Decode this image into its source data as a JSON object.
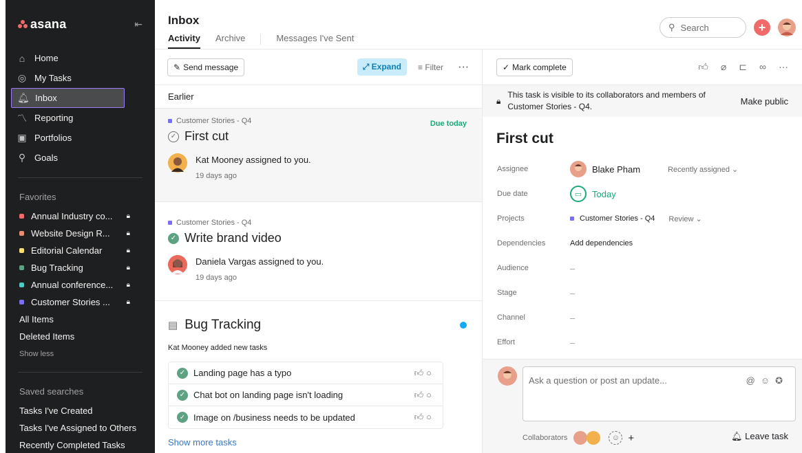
{
  "sidebar": {
    "logo": "asana",
    "nav": [
      {
        "label": "Home",
        "icon": "home-icon"
      },
      {
        "label": "My Tasks",
        "icon": "check-circle-icon"
      },
      {
        "label": "Inbox",
        "icon": "bell-icon"
      },
      {
        "label": "Reporting",
        "icon": "chart-line-icon"
      },
      {
        "label": "Portfolios",
        "icon": "portfolio-icon"
      },
      {
        "label": "Goals",
        "icon": "goals-icon"
      }
    ],
    "favorites_title": "Favorites",
    "favorites": [
      {
        "label": "Annual Industry co...",
        "color": "#f06a6a"
      },
      {
        "label": "Website Design R...",
        "color": "#ec8d71"
      },
      {
        "label": "Editorial Calendar",
        "color": "#f8df72"
      },
      {
        "label": "Bug Tracking",
        "color": "#5da283"
      },
      {
        "label": "Annual conference...",
        "color": "#4ecbc4"
      },
      {
        "label": "Customer Stories ...",
        "color": "#7a6ff0"
      }
    ],
    "all_items": "All Items",
    "deleted_items": "Deleted Items",
    "show_less": "Show less",
    "saved_title": "Saved searches",
    "saved": [
      "Tasks I've Created",
      "Tasks I've Assigned to Others",
      "Recently Completed Tasks"
    ]
  },
  "header": {
    "title": "Inbox",
    "tabs": [
      "Activity",
      "Archive",
      "Messages I've Sent"
    ],
    "search_placeholder": "Search",
    "accent": "#f06a6a"
  },
  "inbox": {
    "send_message": "Send message",
    "expand": "Expand",
    "filter": "Filter",
    "earlier": "Earlier",
    "card1": {
      "project": "Customer Stories - Q4",
      "due": "Due today",
      "title": "First cut",
      "actor": "Kat Mooney assigned to you.",
      "time": "19 days ago"
    },
    "card2": {
      "project": "Customer Stories - Q4",
      "title": "Write brand video",
      "actor": "Daniela Vargas assigned to you.",
      "time": "19 days ago"
    },
    "bug": {
      "title": "Bug Tracking",
      "subtitle": "Kat Mooney added new tasks",
      "tasks": [
        "Landing page has a typo",
        "Chat bot on landing page isn't loading",
        "Image on /business needs to be updated"
      ],
      "show_more": "Show more tasks"
    }
  },
  "detail": {
    "mark_complete": "Mark complete",
    "notice": "This task is visible to its collaborators and members of Customer Stories - Q4.",
    "make_public": "Make public",
    "title": "First cut",
    "labels": {
      "assignee": "Assignee",
      "due": "Due date",
      "projects": "Projects",
      "dependencies": "Dependencies",
      "audience": "Audience",
      "stage": "Stage",
      "channel": "Channel",
      "effort": "Effort"
    },
    "assignee": "Blake Pham",
    "recently_assigned": "Recently assigned",
    "due_value": "Today",
    "project": "Customer Stories - Q4",
    "section": "Review",
    "dependencies_value": "Add dependencies",
    "dash": "–",
    "comment_placeholder": "Ask a question or post an update...",
    "collaborators": "Collaborators",
    "leave_task": "Leave task"
  }
}
